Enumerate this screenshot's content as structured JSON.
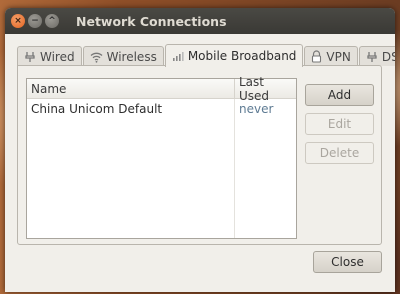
{
  "window": {
    "title": "Network Connections",
    "controls": {
      "close": "×",
      "minimize": "−",
      "maximize": "^"
    }
  },
  "tabs": [
    {
      "label": "Wired",
      "icon": "wired-icon"
    },
    {
      "label": "Wireless",
      "icon": "wireless-icon"
    },
    {
      "label": "Mobile Broadband",
      "icon": "signal-icon",
      "active": true
    },
    {
      "label": "VPN",
      "icon": "vpn-lock-icon"
    },
    {
      "label": "DSL",
      "icon": "dsl-icon"
    }
  ],
  "list": {
    "columns": [
      "Name",
      "Last Used"
    ],
    "rows": [
      {
        "name": "China Unicom Default",
        "last_used": "never"
      }
    ]
  },
  "buttons": {
    "add": "Add",
    "edit": "Edit",
    "delete": "Delete",
    "close": "Close"
  },
  "colors": {
    "titlebar": "#3a3935",
    "close_button": "#e2621f",
    "last_used_text": "#5e7b93"
  }
}
